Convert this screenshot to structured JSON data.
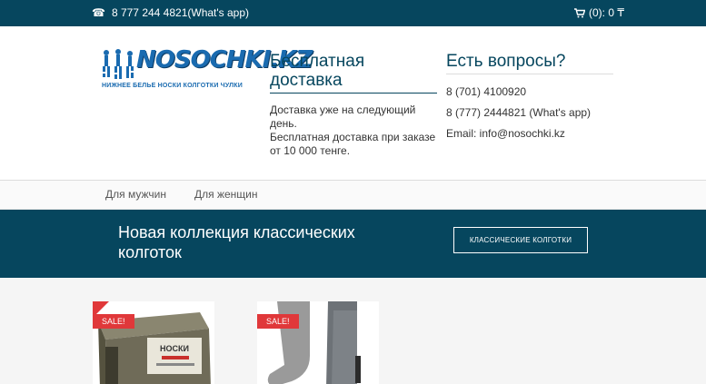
{
  "topbar": {
    "phone": "8 777 244 4821(What's app)",
    "cart": "(0): 0 ₸"
  },
  "logo": {
    "word": "NOSOCHKI.KZ",
    "tagline": "НИЖНЕЕ БЕЛЬЕ НОСКИ КОЛГОТКИ ЧУЛКИ"
  },
  "delivery": {
    "title": "Бесплатная доставка",
    "text1": "Доставка уже на следующий день.",
    "text2": "Бесплатная доставка при заказе от 10 000 тенге."
  },
  "contacts": {
    "title": "Есть вопросы?",
    "phone1": "8 (701) 4100920",
    "phone2": "8 (777) 2444821 (What's app)",
    "email": "Email: info@nosochki.kz"
  },
  "nav": {
    "men": "Для мужчин",
    "women": "Для женщин"
  },
  "banner": {
    "title": "Новая коллекция классических колготок",
    "button": "Классические колготки"
  },
  "products": [
    {
      "badge": "SALE!",
      "box_label": "НОСКИ"
    },
    {
      "badge": "SALE!"
    }
  ],
  "colors": {
    "primary": "#06465e",
    "sale": "#e0383a",
    "logo": "#1a6bb0"
  }
}
